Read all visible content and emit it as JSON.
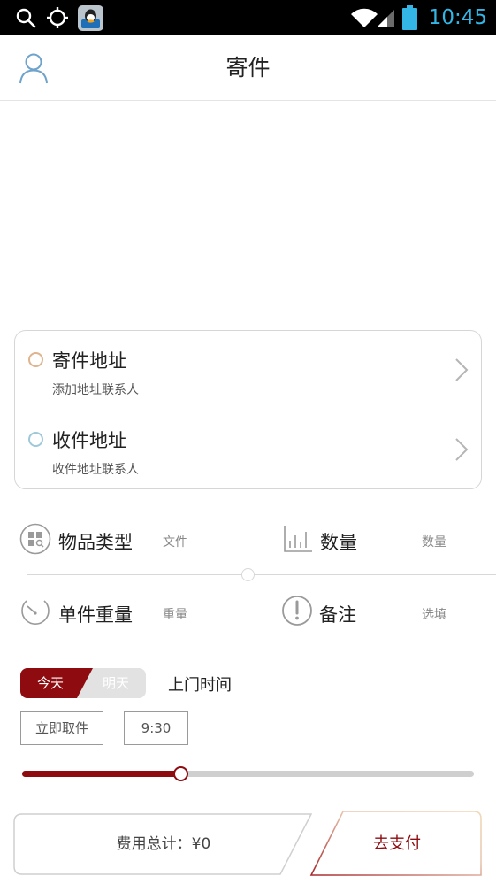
{
  "status_bar": {
    "time": "10:45",
    "icons": [
      "search-icon",
      "gps-icon",
      "qq-icon",
      "wifi-icon",
      "cell-signal-icon",
      "battery-icon"
    ]
  },
  "header": {
    "title": "寄件",
    "avatar_icon": "user-icon"
  },
  "address": {
    "sender": {
      "label": "寄件地址",
      "hint": "添加地址联系人",
      "dot_color": "#e0b48e"
    },
    "receiver": {
      "label": "收件地址",
      "hint": "收件地址联系人",
      "dot_color": "#9ec9d9"
    }
  },
  "grid": {
    "item_type": {
      "label": "物品类型",
      "value": "文件",
      "icon": "category-icon"
    },
    "quantity": {
      "label": "数量",
      "value": "数量",
      "icon": "bar-chart-icon"
    },
    "weight": {
      "label": "单件重量",
      "value": "重量",
      "icon": "scale-gauge-icon"
    },
    "note": {
      "label": "备注",
      "value": "选填",
      "icon": "exclamation-icon"
    }
  },
  "pickup": {
    "today": "今天",
    "tomorrow": "明天",
    "selected": "今天",
    "label": "上门时间",
    "immediate": "立即取件",
    "time": "9:30",
    "slider_fraction": 0.35
  },
  "footer": {
    "fee": "费用总计：¥0",
    "pay": "去支付"
  },
  "colors": {
    "accent": "#8e0c10",
    "status_time": "#33b5e5"
  }
}
